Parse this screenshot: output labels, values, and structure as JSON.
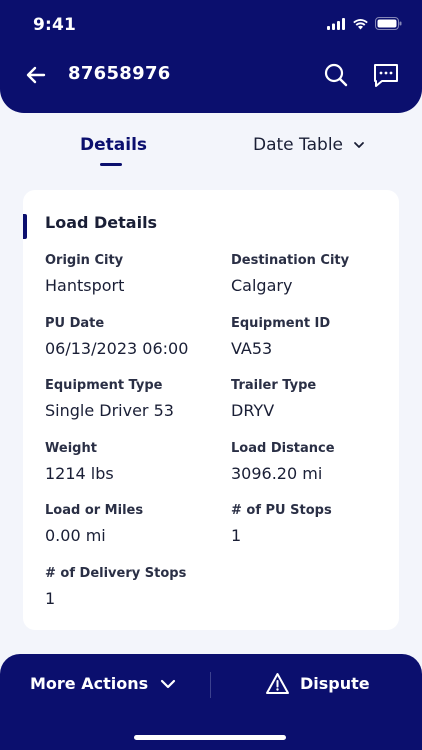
{
  "status_bar": {
    "time": "9:41"
  },
  "header": {
    "load_id": "87658976"
  },
  "tabs": {
    "details_label": "Details",
    "date_table_label": "Date Table"
  },
  "card": {
    "title": "Load Details",
    "fields": [
      {
        "label": "Origin City",
        "value": "Hantsport"
      },
      {
        "label": "Destination City",
        "value": "Calgary"
      },
      {
        "label": "PU Date",
        "value": "06/13/2023 06:00"
      },
      {
        "label": "Equipment ID",
        "value": "VA53"
      },
      {
        "label": "Equipment Type",
        "value": "Single Driver 53"
      },
      {
        "label": "Trailer Type",
        "value": "DRYV"
      },
      {
        "label": "Weight",
        "value": "1214 lbs"
      },
      {
        "label": "Load Distance",
        "value": "3096.20 mi"
      },
      {
        "label": "Load or Miles",
        "value": "0.00 mi"
      },
      {
        "label": "# of PU Stops",
        "value": "1"
      },
      {
        "label": "# of Delivery Stops",
        "value": "1"
      }
    ]
  },
  "bottom_bar": {
    "more_actions_label": "More Actions",
    "dispute_label": "Dispute"
  },
  "icons": {
    "back": "arrow-left-icon",
    "search": "search-icon",
    "chat": "chat-icon",
    "chevron": "chevron-down-icon",
    "dispute": "warning-triangle-icon"
  },
  "colors": {
    "primary": "#0b0f6e",
    "background": "#f3f5fb",
    "card": "#ffffff"
  }
}
